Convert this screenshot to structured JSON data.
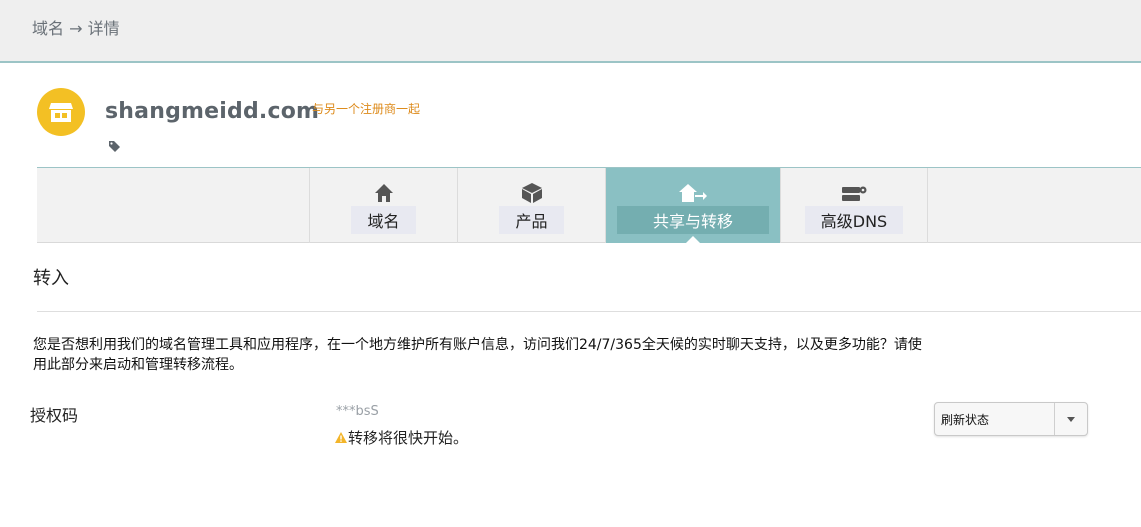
{
  "breadcrumb": {
    "text": "域名 → 详情"
  },
  "domain": {
    "name": "shangmeidd.com",
    "registrar_note": "与另一个注册商一起",
    "icon": "store-icon",
    "icon_color": "#f3c024"
  },
  "tabs": [
    {
      "label": "域名",
      "icon": "home-icon",
      "active": false
    },
    {
      "label": "产品",
      "icon": "box-icon",
      "active": false
    },
    {
      "label": "共享与转移",
      "icon": "share-transfer-icon",
      "active": true
    },
    {
      "label": "高级DNS",
      "icon": "server-icon",
      "active": false
    }
  ],
  "section": {
    "title": "转入",
    "description": "您是否想利用我们的域名管理工具和应用程序，在一个地方维护所有账户信息，访问我们24/7/365全天候的实时聊天支持，以及更多功能？请使用此部分来启动和管理转移流程。"
  },
  "auth": {
    "label": "授权码",
    "code": "***bsS",
    "status": "转移将很快开始。",
    "status_icon": "warning-icon"
  },
  "action_select": {
    "value": "刷新状态"
  },
  "colors": {
    "accent_teal": "#8ac0c3",
    "warning": "#f3b52a",
    "note_orange": "#dd8a1a"
  }
}
